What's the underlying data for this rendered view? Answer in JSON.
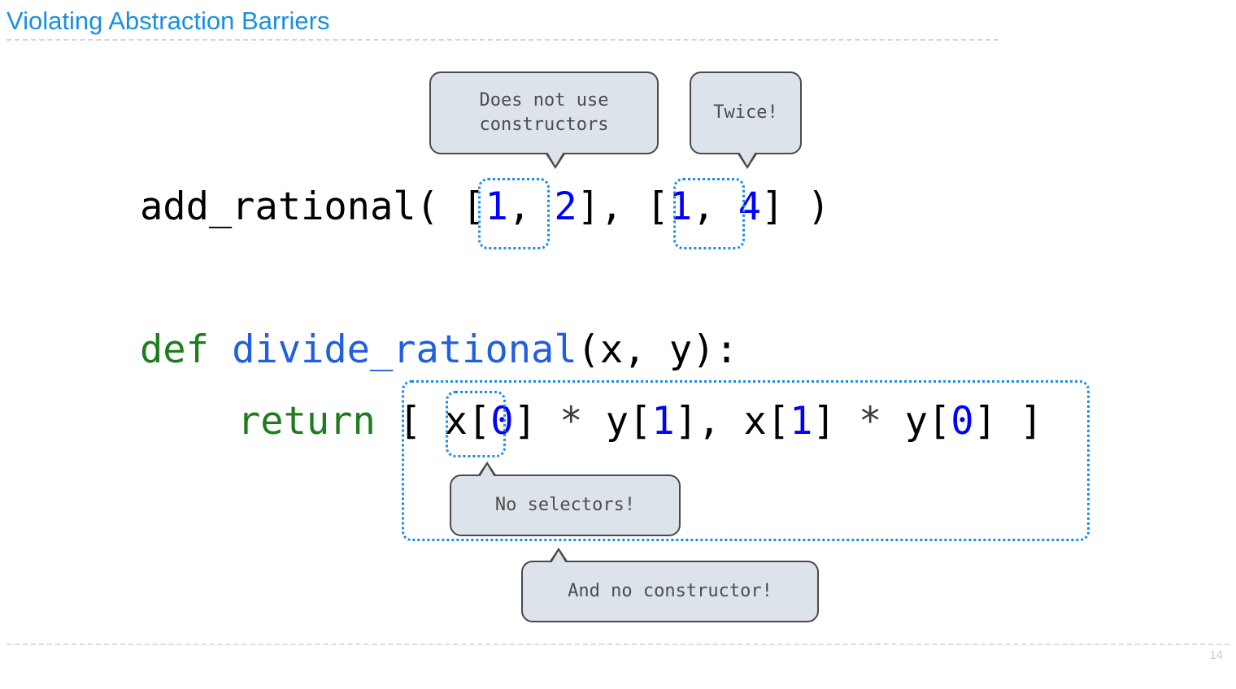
{
  "slide": {
    "title": "Violating Abstraction Barriers",
    "page_number": "14"
  },
  "colors": {
    "title_blue": "#1a8fe0",
    "keyword_green": "#1e7c1e",
    "function_blue": "#1f5fe0",
    "number_blue": "#0000ff",
    "dotted_box_blue": "#1a8cf0",
    "callout_fill": "#dde3ea",
    "callout_border": "#4a4a4a",
    "callout_text": "#4d4d4d",
    "rule_gray": "#d4d4d4",
    "page_number_gray": "#c8cdd4"
  },
  "code": {
    "call_line": {
      "name_part": "add_rational( ",
      "arg1_open": "[",
      "arg1_first": "1",
      "arg1_sep": ", ",
      "arg1_second": "2",
      "arg1_close": "]",
      "between": ", ",
      "arg2_open": "[",
      "arg2_first": "1",
      "arg2_sep": ", ",
      "arg2_second": "4",
      "arg2_close": "]",
      "tail": " )"
    },
    "def_line": {
      "keyword": "def ",
      "fname": "divide_rational",
      "params": "(x, y):"
    },
    "return_line": {
      "keyword": "return ",
      "open_bracket": "[ ",
      "t1_var": "x[",
      "t1_num": "0",
      "t1_close": "]",
      "op1": " * ",
      "t2_var": "y[",
      "t2_num": "1",
      "t2_close": "]",
      "comma": ", ",
      "t3_var": "x[",
      "t3_num": "1",
      "t3_close": "]",
      "op2": " * ",
      "t4_var": "y[",
      "t4_num": "0",
      "t4_close": "]",
      "close_bracket": " ]"
    }
  },
  "callouts": [
    {
      "id": "does-not-use-constructors",
      "text": "Does not use\nconstructors",
      "tail": "down"
    },
    {
      "id": "twice",
      "text": "Twice!",
      "tail": "down"
    },
    {
      "id": "no-selectors",
      "text": "No selectors!",
      "tail": "up"
    },
    {
      "id": "and-no-constructor",
      "text": "And no constructor!",
      "tail": "up"
    }
  ]
}
